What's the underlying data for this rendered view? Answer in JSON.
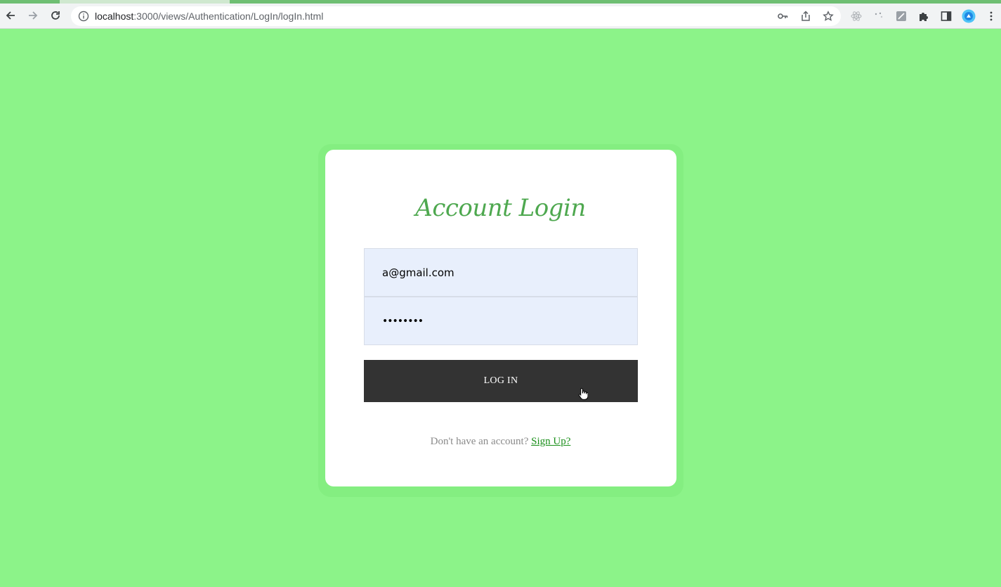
{
  "browser": {
    "url_host": "localhost",
    "url_rest": ":3000/views/Authentication/LogIn/logIn.html"
  },
  "login": {
    "title": "Account Login",
    "email_value": "a@gmail.com",
    "password_value": "••••••••",
    "submit_label": "LOG IN",
    "signup_prompt": "Don't have an account?",
    "signup_link": "Sign Up?"
  },
  "colors": {
    "page_background": "#8cf389",
    "title_green": "#4ea84f",
    "field_background": "#e8effc",
    "button_background": "#333333",
    "link_green": "#1a8f1a"
  }
}
